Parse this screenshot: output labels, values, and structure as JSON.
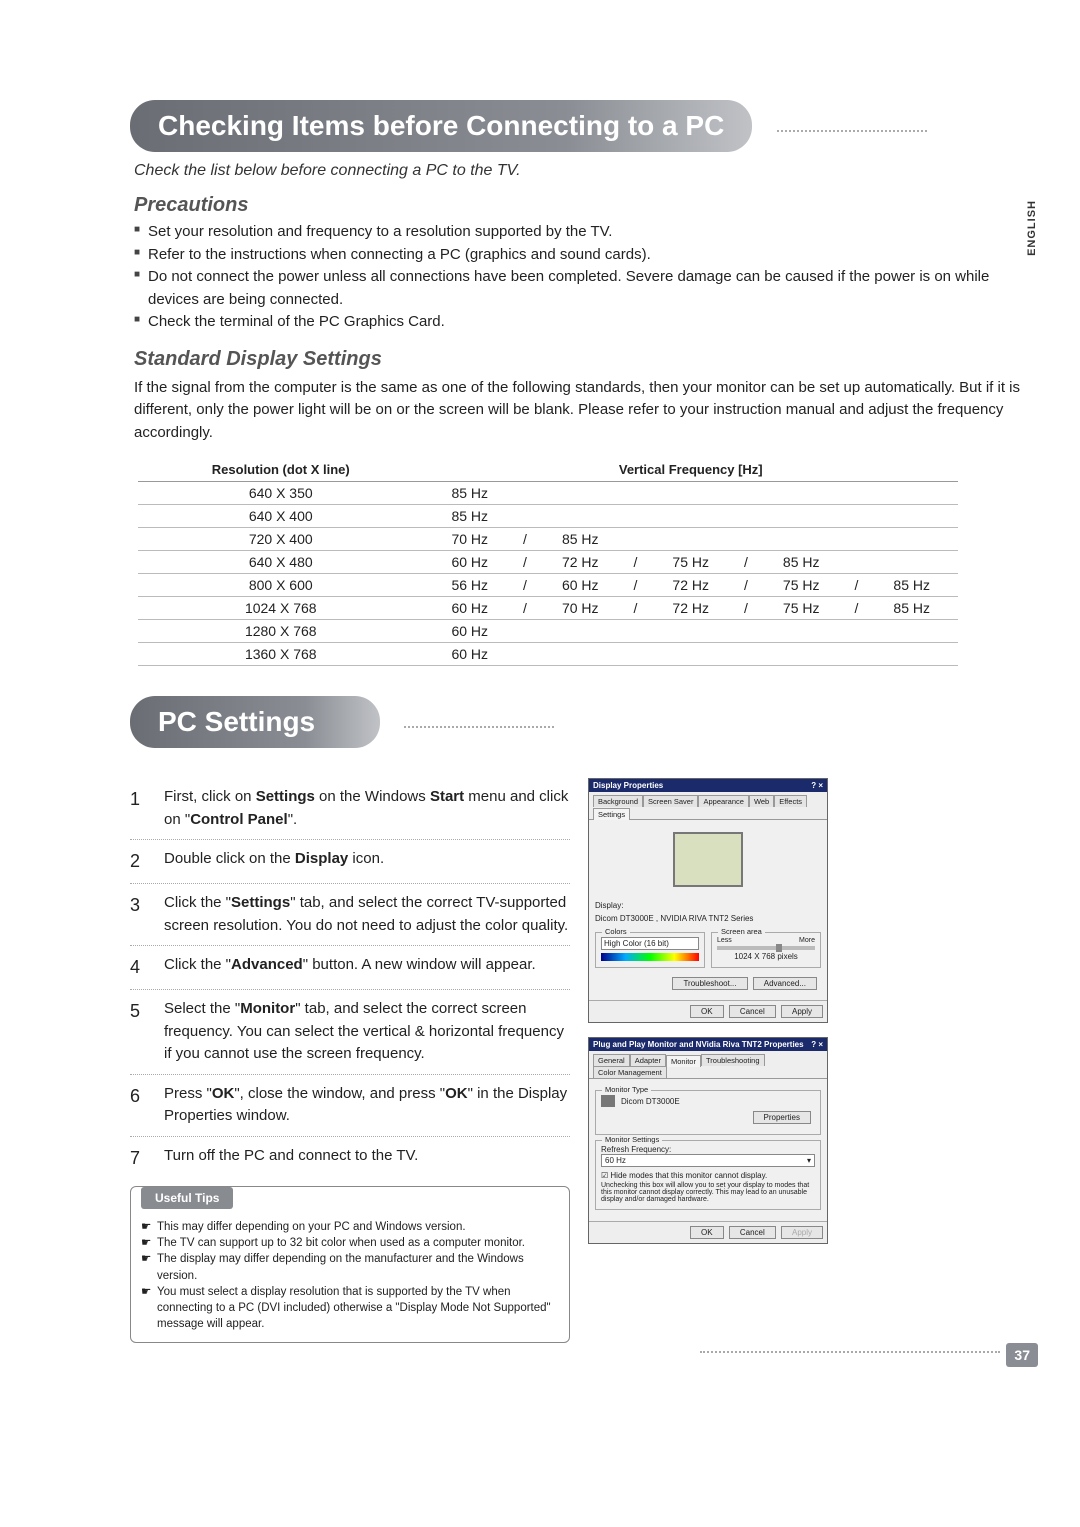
{
  "language_tab": "ENGLISH",
  "page_number": "37",
  "heading1": "Checking Items before Connecting to a PC",
  "subtitle1": "Check the list below before connecting a PC to the TV.",
  "precautions": {
    "head": "Precautions",
    "items": [
      "Set your resolution and frequency to a resolution supported by the TV.",
      "Refer to the instructions when connecting a PC (graphics and sound cards).",
      "Do not connect the power unless all connections have been completed. Severe damage can be caused if the power is on while devices are being connected.",
      "Check the terminal of the PC Graphics Card."
    ]
  },
  "std_settings": {
    "head": "Standard Display Settings",
    "para": "If the signal from the computer is the same as one of the following standards, then your monitor can be set up automatically. But if it is different, only the power light will be on or the screen will be blank. Please refer to your instruction manual and adjust the frequency accordingly.",
    "col_res": "Resolution  (dot X line)",
    "col_freq": "Vertical Frequency  [Hz]",
    "rows": [
      {
        "res": "640  X  350",
        "hz": [
          "85 Hz"
        ]
      },
      {
        "res": "640  X  400",
        "hz": [
          "85 Hz"
        ]
      },
      {
        "res": "720  X  400",
        "hz": [
          "70 Hz",
          "85 Hz"
        ]
      },
      {
        "res": "640  X  480",
        "hz": [
          "60 Hz",
          "72 Hz",
          "75 Hz",
          "85 Hz"
        ]
      },
      {
        "res": "800  X  600",
        "hz": [
          "56 Hz",
          "60 Hz",
          "72 Hz",
          "75 Hz",
          "85 Hz"
        ]
      },
      {
        "res": "1024  X  768",
        "hz": [
          "60 Hz",
          "70 Hz",
          "72 Hz",
          "75 Hz",
          "85 Hz"
        ]
      },
      {
        "res": "1280  X  768",
        "hz": [
          "60 Hz"
        ]
      },
      {
        "res": "1360  X  768",
        "hz": [
          "60 Hz"
        ]
      }
    ]
  },
  "heading2": "PC Settings",
  "steps": [
    "First, click on <b>Settings</b> on the Windows <b>Start</b> menu and click on \"<b>Control Panel</b>\".",
    "Double click on the <b>Display</b> icon.",
    "Click the \"<b>Settings</b>\" tab, and select the correct TV-supported screen resolution. You do not need to adjust the color quality.",
    "Click the \"<b>Advanced</b>\" button. A new window will appear.",
    "Select the \"<b>Monitor</b>\" tab, and select the correct screen frequency. You can select the vertical & horizontal frequency if you cannot use the screen frequency.",
    "Press \"<b>OK</b>\", close the window, and press \"<b>OK</b>\" in the Display Properties window.",
    "Turn off the PC and connect to the TV."
  ],
  "tips": {
    "label": "Useful Tips",
    "items": [
      "This may differ depending on your PC and Windows version.",
      "The TV can support up to 32 bit color when used as a computer monitor.",
      "The display may differ depending on the manufacturer and the Windows version.",
      "You must select a display resolution that is supported by the TV when connecting to a PC (DVI included) otherwise a \"Display Mode Not Supported\" message will appear."
    ]
  },
  "dialog1": {
    "title": "Display Properties",
    "tabs": [
      "Background",
      "Screen Saver",
      "Appearance",
      "Web",
      "Effects",
      "Settings"
    ],
    "display_label": "Display:",
    "display_value": "Dicom DT3000E , NVIDIA RIVA TNT2 Series",
    "colors_label": "Colors",
    "colors_value": "High Color (16 bit)",
    "screen_area_label": "Screen area",
    "less": "Less",
    "more": "More",
    "resolution": "1024 X 768 pixels",
    "troubleshoot": "Troubleshoot...",
    "advanced": "Advanced...",
    "ok": "OK",
    "cancel": "Cancel",
    "apply": "Apply"
  },
  "dialog2": {
    "title": "Plug and Play Monitor and NVidia Riva TNT2 Properties",
    "tabs": [
      "General",
      "Adapter",
      "Monitor",
      "Troubleshooting",
      "Color Management"
    ],
    "monitor_type": "Monitor Type",
    "monitor_name": "Dicom DT3000E",
    "properties": "Properties",
    "monitor_settings": "Monitor Settings",
    "refresh_label": "Refresh Frequency:",
    "refresh_value": "60 Hz",
    "hide_check": "Hide modes that this monitor cannot display.",
    "hide_note": "Unchecking this box will allow you to set your display to modes that this monitor cannot display correctly. This may lead to an unusable display and/or damaged hardware.",
    "ok": "OK",
    "cancel": "Cancel",
    "apply": "Apply"
  }
}
